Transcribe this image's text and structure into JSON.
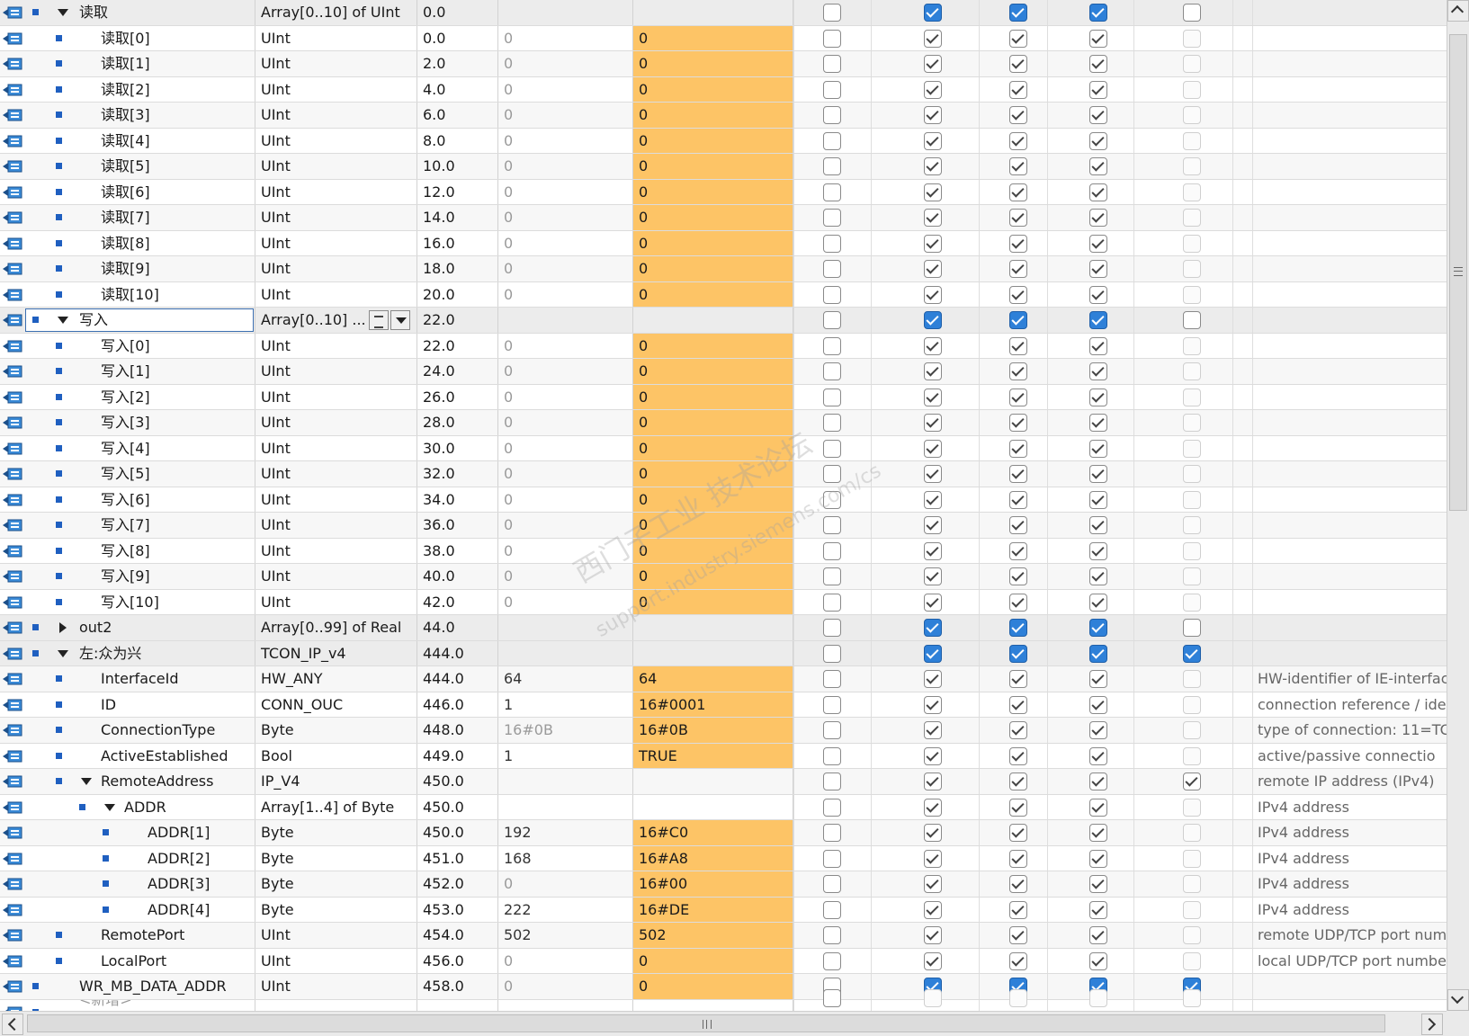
{
  "watermark": {
    "line1": "西门子工业 技术论坛",
    "line2": "support.industry.siemens.com/cs"
  },
  "rows": [
    {
      "level": 0,
      "expand": "down",
      "bullet": true,
      "name": "读取",
      "type": "Array[0..10] of UInt",
      "offset": "0.0",
      "default": "",
      "start": "",
      "cb": [
        false,
        true,
        true,
        true,
        false
      ],
      "cbStyle": "blue",
      "comment": "",
      "hdr": true
    },
    {
      "level": 1,
      "bullet": true,
      "name": "读取[0]",
      "type": "UInt",
      "offset": "0.0",
      "default": "0",
      "start": "0",
      "cb": [
        false,
        true,
        true,
        true,
        false
      ],
      "cbStyle": "grey",
      "comment": ""
    },
    {
      "level": 1,
      "bullet": true,
      "name": "读取[1]",
      "type": "UInt",
      "offset": "2.0",
      "default": "0",
      "start": "0",
      "cb": [
        false,
        true,
        true,
        true,
        false
      ],
      "cbStyle": "grey",
      "comment": ""
    },
    {
      "level": 1,
      "bullet": true,
      "name": "读取[2]",
      "type": "UInt",
      "offset": "4.0",
      "default": "0",
      "start": "0",
      "cb": [
        false,
        true,
        true,
        true,
        false
      ],
      "cbStyle": "grey",
      "comment": ""
    },
    {
      "level": 1,
      "bullet": true,
      "name": "读取[3]",
      "type": "UInt",
      "offset": "6.0",
      "default": "0",
      "start": "0",
      "cb": [
        false,
        true,
        true,
        true,
        false
      ],
      "cbStyle": "grey",
      "comment": ""
    },
    {
      "level": 1,
      "bullet": true,
      "name": "读取[4]",
      "type": "UInt",
      "offset": "8.0",
      "default": "0",
      "start": "0",
      "cb": [
        false,
        true,
        true,
        true,
        false
      ],
      "cbStyle": "grey",
      "comment": ""
    },
    {
      "level": 1,
      "bullet": true,
      "name": "读取[5]",
      "type": "UInt",
      "offset": "10.0",
      "default": "0",
      "start": "0",
      "cb": [
        false,
        true,
        true,
        true,
        false
      ],
      "cbStyle": "grey",
      "comment": ""
    },
    {
      "level": 1,
      "bullet": true,
      "name": "读取[6]",
      "type": "UInt",
      "offset": "12.0",
      "default": "0",
      "start": "0",
      "cb": [
        false,
        true,
        true,
        true,
        false
      ],
      "cbStyle": "grey",
      "comment": ""
    },
    {
      "level": 1,
      "bullet": true,
      "name": "读取[7]",
      "type": "UInt",
      "offset": "14.0",
      "default": "0",
      "start": "0",
      "cb": [
        false,
        true,
        true,
        true,
        false
      ],
      "cbStyle": "grey",
      "comment": ""
    },
    {
      "level": 1,
      "bullet": true,
      "name": "读取[8]",
      "type": "UInt",
      "offset": "16.0",
      "default": "0",
      "start": "0",
      "cb": [
        false,
        true,
        true,
        true,
        false
      ],
      "cbStyle": "grey",
      "comment": ""
    },
    {
      "level": 1,
      "bullet": true,
      "name": "读取[9]",
      "type": "UInt",
      "offset": "18.0",
      "default": "0",
      "start": "0",
      "cb": [
        false,
        true,
        true,
        true,
        false
      ],
      "cbStyle": "grey",
      "comment": ""
    },
    {
      "level": 1,
      "bullet": true,
      "name": "读取[10]",
      "type": "UInt",
      "offset": "20.0",
      "default": "0",
      "start": "0",
      "cb": [
        false,
        true,
        true,
        true,
        false
      ],
      "cbStyle": "grey",
      "comment": ""
    },
    {
      "level": 0,
      "expand": "down",
      "bullet": true,
      "name": "写入",
      "type": "Array[0..10] ...",
      "offset": "22.0",
      "default": "",
      "start": "",
      "cb": [
        false,
        true,
        true,
        true,
        false
      ],
      "cbStyle": "blue",
      "comment": "",
      "hdr": true,
      "selected": true
    },
    {
      "level": 1,
      "bullet": true,
      "name": "写入[0]",
      "type": "UInt",
      "offset": "22.0",
      "default": "0",
      "start": "0",
      "cb": [
        false,
        true,
        true,
        true,
        false
      ],
      "cbStyle": "grey",
      "comment": ""
    },
    {
      "level": 1,
      "bullet": true,
      "name": "写入[1]",
      "type": "UInt",
      "offset": "24.0",
      "default": "0",
      "start": "0",
      "cb": [
        false,
        true,
        true,
        true,
        false
      ],
      "cbStyle": "grey",
      "comment": ""
    },
    {
      "level": 1,
      "bullet": true,
      "name": "写入[2]",
      "type": "UInt",
      "offset": "26.0",
      "default": "0",
      "start": "0",
      "cb": [
        false,
        true,
        true,
        true,
        false
      ],
      "cbStyle": "grey",
      "comment": ""
    },
    {
      "level": 1,
      "bullet": true,
      "name": "写入[3]",
      "type": "UInt",
      "offset": "28.0",
      "default": "0",
      "start": "0",
      "cb": [
        false,
        true,
        true,
        true,
        false
      ],
      "cbStyle": "grey",
      "comment": ""
    },
    {
      "level": 1,
      "bullet": true,
      "name": "写入[4]",
      "type": "UInt",
      "offset": "30.0",
      "default": "0",
      "start": "0",
      "cb": [
        false,
        true,
        true,
        true,
        false
      ],
      "cbStyle": "grey",
      "comment": ""
    },
    {
      "level": 1,
      "bullet": true,
      "name": "写入[5]",
      "type": "UInt",
      "offset": "32.0",
      "default": "0",
      "start": "0",
      "cb": [
        false,
        true,
        true,
        true,
        false
      ],
      "cbStyle": "grey",
      "comment": ""
    },
    {
      "level": 1,
      "bullet": true,
      "name": "写入[6]",
      "type": "UInt",
      "offset": "34.0",
      "default": "0",
      "start": "0",
      "cb": [
        false,
        true,
        true,
        true,
        false
      ],
      "cbStyle": "grey",
      "comment": ""
    },
    {
      "level": 1,
      "bullet": true,
      "name": "写入[7]",
      "type": "UInt",
      "offset": "36.0",
      "default": "0",
      "start": "0",
      "cb": [
        false,
        true,
        true,
        true,
        false
      ],
      "cbStyle": "grey",
      "comment": ""
    },
    {
      "level": 1,
      "bullet": true,
      "name": "写入[8]",
      "type": "UInt",
      "offset": "38.0",
      "default": "0",
      "start": "0",
      "cb": [
        false,
        true,
        true,
        true,
        false
      ],
      "cbStyle": "grey",
      "comment": ""
    },
    {
      "level": 1,
      "bullet": true,
      "name": "写入[9]",
      "type": "UInt",
      "offset": "40.0",
      "default": "0",
      "start": "0",
      "cb": [
        false,
        true,
        true,
        true,
        false
      ],
      "cbStyle": "grey",
      "comment": ""
    },
    {
      "level": 1,
      "bullet": true,
      "name": "写入[10]",
      "type": "UInt",
      "offset": "42.0",
      "default": "0",
      "start": "0",
      "cb": [
        false,
        true,
        true,
        true,
        false
      ],
      "cbStyle": "grey",
      "comment": ""
    },
    {
      "level": 0,
      "expand": "right",
      "bullet": true,
      "name": "out2",
      "type": "Array[0..99] of Real",
      "offset": "44.0",
      "default": "",
      "start": "",
      "cb": [
        false,
        true,
        true,
        true,
        false
      ],
      "cbStyle": "blue",
      "comment": "",
      "hdr": true
    },
    {
      "level": 0,
      "expand": "down",
      "bullet": true,
      "name": "左:众为兴",
      "type": "TCON_IP_v4",
      "offset": "444.0",
      "default": "",
      "start": "",
      "cb": [
        false,
        true,
        true,
        true,
        true
      ],
      "cbStyle": "blue",
      "comment": "",
      "hdr": true
    },
    {
      "level": 1,
      "bullet": true,
      "name": "InterfaceId",
      "type": "HW_ANY",
      "offset": "444.0",
      "default": "64",
      "start": "64",
      "cb": [
        false,
        true,
        true,
        true,
        false
      ],
      "cbStyle": "grey",
      "comment": "HW-identifier of IE-interfac"
    },
    {
      "level": 1,
      "bullet": true,
      "name": "ID",
      "type": "CONN_OUC",
      "offset": "446.0",
      "default": "1",
      "start": "16#0001",
      "cb": [
        false,
        true,
        true,
        true,
        false
      ],
      "cbStyle": "grey",
      "comment": "connection reference / ide"
    },
    {
      "level": 1,
      "bullet": true,
      "name": "ConnectionType",
      "type": "Byte",
      "offset": "448.0",
      "default": "16#0B",
      "defaultGrey": true,
      "start": "16#0B",
      "cb": [
        false,
        true,
        true,
        true,
        false
      ],
      "cbStyle": "grey",
      "comment": "type of connection: 11=TC"
    },
    {
      "level": 1,
      "bullet": true,
      "name": "ActiveEstablished",
      "type": "Bool",
      "offset": "449.0",
      "default": "1",
      "start": "TRUE",
      "cb": [
        false,
        true,
        true,
        true,
        false
      ],
      "cbStyle": "grey",
      "comment": "active/passive connectio"
    },
    {
      "level": 1,
      "expand": "down",
      "bullet": true,
      "name": "RemoteAddress",
      "type": "IP_V4",
      "offset": "450.0",
      "default": "",
      "start": "",
      "cb": [
        false,
        true,
        true,
        true,
        true
      ],
      "cbStyle": "grey",
      "comment": "remote IP address (IPv4)"
    },
    {
      "level": 2,
      "expand": "down",
      "bullet": true,
      "name": "ADDR",
      "type": "Array[1..4] of Byte",
      "offset": "450.0",
      "default": "",
      "start": "",
      "cb": [
        false,
        true,
        true,
        true,
        false
      ],
      "cbStyle": "grey",
      "comment": "IPv4 address"
    },
    {
      "level": 3,
      "bullet": true,
      "name": "ADDR[1]",
      "type": "Byte",
      "offset": "450.0",
      "default": "192",
      "start": "16#C0",
      "cb": [
        false,
        true,
        true,
        true,
        false
      ],
      "cbStyle": "grey",
      "comment": "IPv4 address"
    },
    {
      "level": 3,
      "bullet": true,
      "name": "ADDR[2]",
      "type": "Byte",
      "offset": "451.0",
      "default": "168",
      "start": "16#A8",
      "cb": [
        false,
        true,
        true,
        true,
        false
      ],
      "cbStyle": "grey",
      "comment": "IPv4 address"
    },
    {
      "level": 3,
      "bullet": true,
      "name": "ADDR[3]",
      "type": "Byte",
      "offset": "452.0",
      "default": "0",
      "start": "16#00",
      "cb": [
        false,
        true,
        true,
        true,
        false
      ],
      "cbStyle": "grey",
      "comment": "IPv4 address"
    },
    {
      "level": 3,
      "bullet": true,
      "name": "ADDR[4]",
      "type": "Byte",
      "offset": "453.0",
      "default": "222",
      "start": "16#DE",
      "cb": [
        false,
        true,
        true,
        true,
        false
      ],
      "cbStyle": "grey",
      "comment": "IPv4 address"
    },
    {
      "level": 1,
      "bullet": true,
      "name": "RemotePort",
      "type": "UInt",
      "offset": "454.0",
      "default": "502",
      "start": "502",
      "cb": [
        false,
        true,
        true,
        true,
        false
      ],
      "cbStyle": "grey",
      "comment": "remote UDP/TCP port num"
    },
    {
      "level": 1,
      "bullet": true,
      "name": "LocalPort",
      "type": "UInt",
      "offset": "456.0",
      "default": "0",
      "start": "0",
      "cb": [
        false,
        true,
        true,
        true,
        false
      ],
      "cbStyle": "grey",
      "comment": "local UDP/TCP port numbe"
    },
    {
      "level": 0,
      "bullet": true,
      "name": "WR_MB_DATA_ADDR",
      "type": "UInt",
      "offset": "458.0",
      "default": "0",
      "start": "0",
      "cb": [
        false,
        true,
        true,
        true,
        true
      ],
      "cbStyle": "blue",
      "comment": ""
    },
    {
      "level": 0,
      "bullet": true,
      "name": "<新增>",
      "type": "",
      "offset": "",
      "default": "",
      "start": "",
      "cb": [
        false,
        false,
        false,
        false,
        false
      ],
      "cbStyle": "light",
      "comment": "",
      "partial": true
    }
  ],
  "colors": {
    "startValue": "#fdc466",
    "blueCheck": "#2e80d8"
  }
}
